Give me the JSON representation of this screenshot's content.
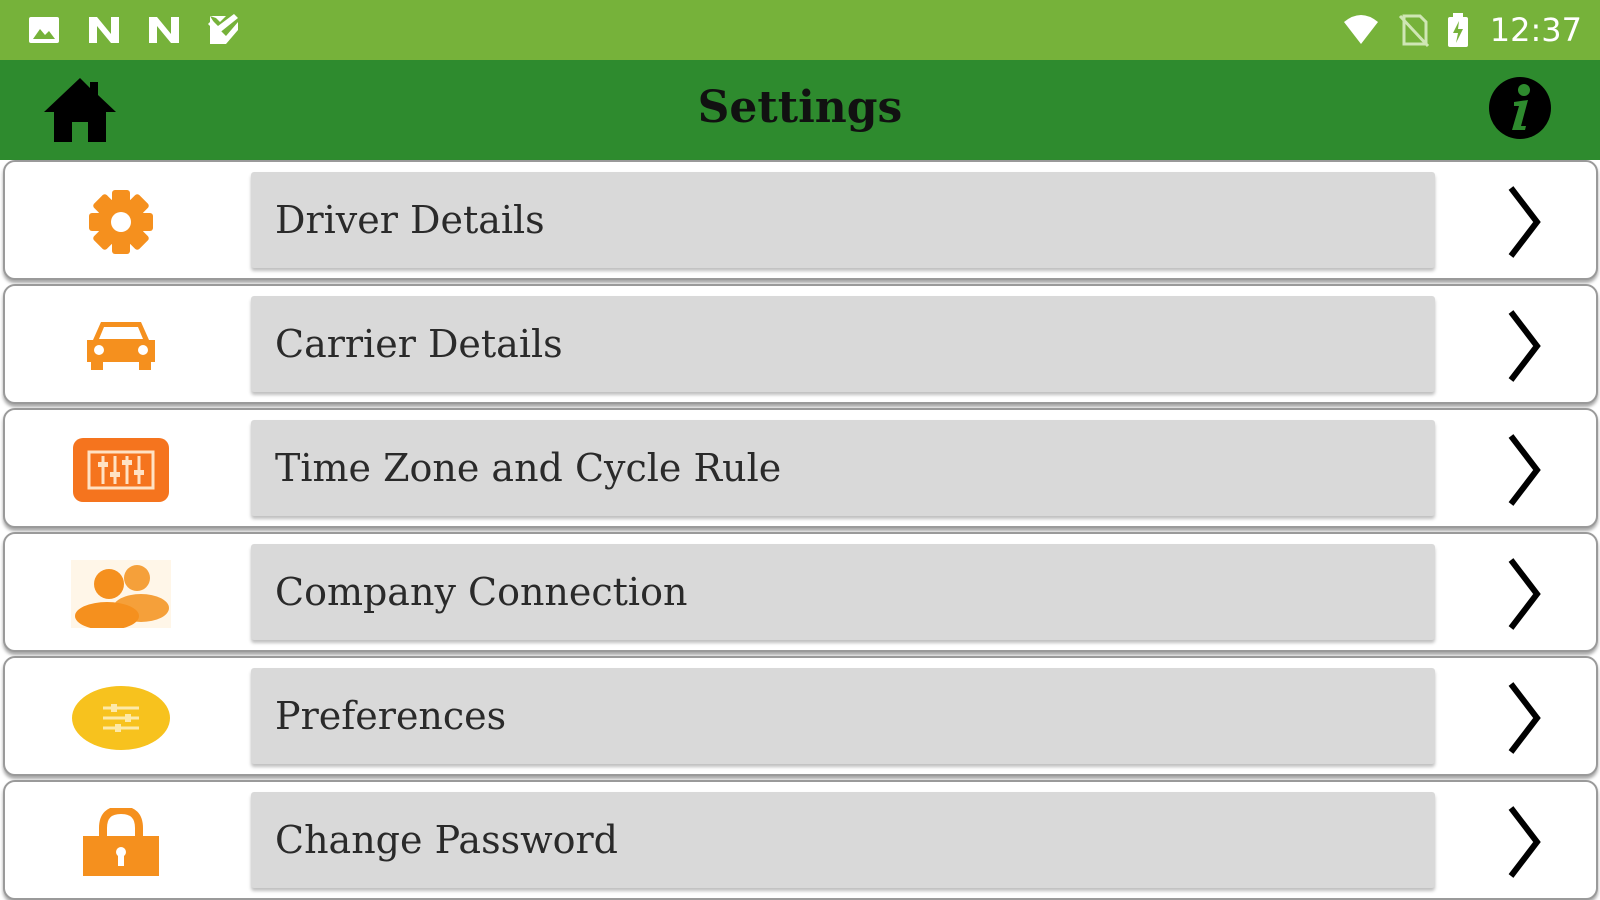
{
  "status_bar": {
    "time": "12:37",
    "left_icons": [
      "gallery-icon",
      "n-app-icon",
      "n-app-icon",
      "checklist-icon"
    ],
    "right_icons": [
      "wifi-icon",
      "no-sim-icon",
      "battery-charging-icon"
    ]
  },
  "app_bar": {
    "title": "Settings",
    "home_icon": "home-icon",
    "info_icon": "info-icon",
    "background_color": "#2e8b2e"
  },
  "colors": {
    "status_bar": "#76b23a",
    "accent_orange": "#f5901e",
    "label_background": "#d9d9d9"
  },
  "settings": [
    {
      "label": "Driver Details",
      "icon": "gear-icon"
    },
    {
      "label": "Carrier Details",
      "icon": "car-icon"
    },
    {
      "label": "Time Zone and Cycle Rule",
      "icon": "equalizer-icon"
    },
    {
      "label": "Company Connection",
      "icon": "users-icon"
    },
    {
      "label": "Preferences",
      "icon": "sliders-icon"
    },
    {
      "label": "Change Password",
      "icon": "lock-icon"
    }
  ]
}
